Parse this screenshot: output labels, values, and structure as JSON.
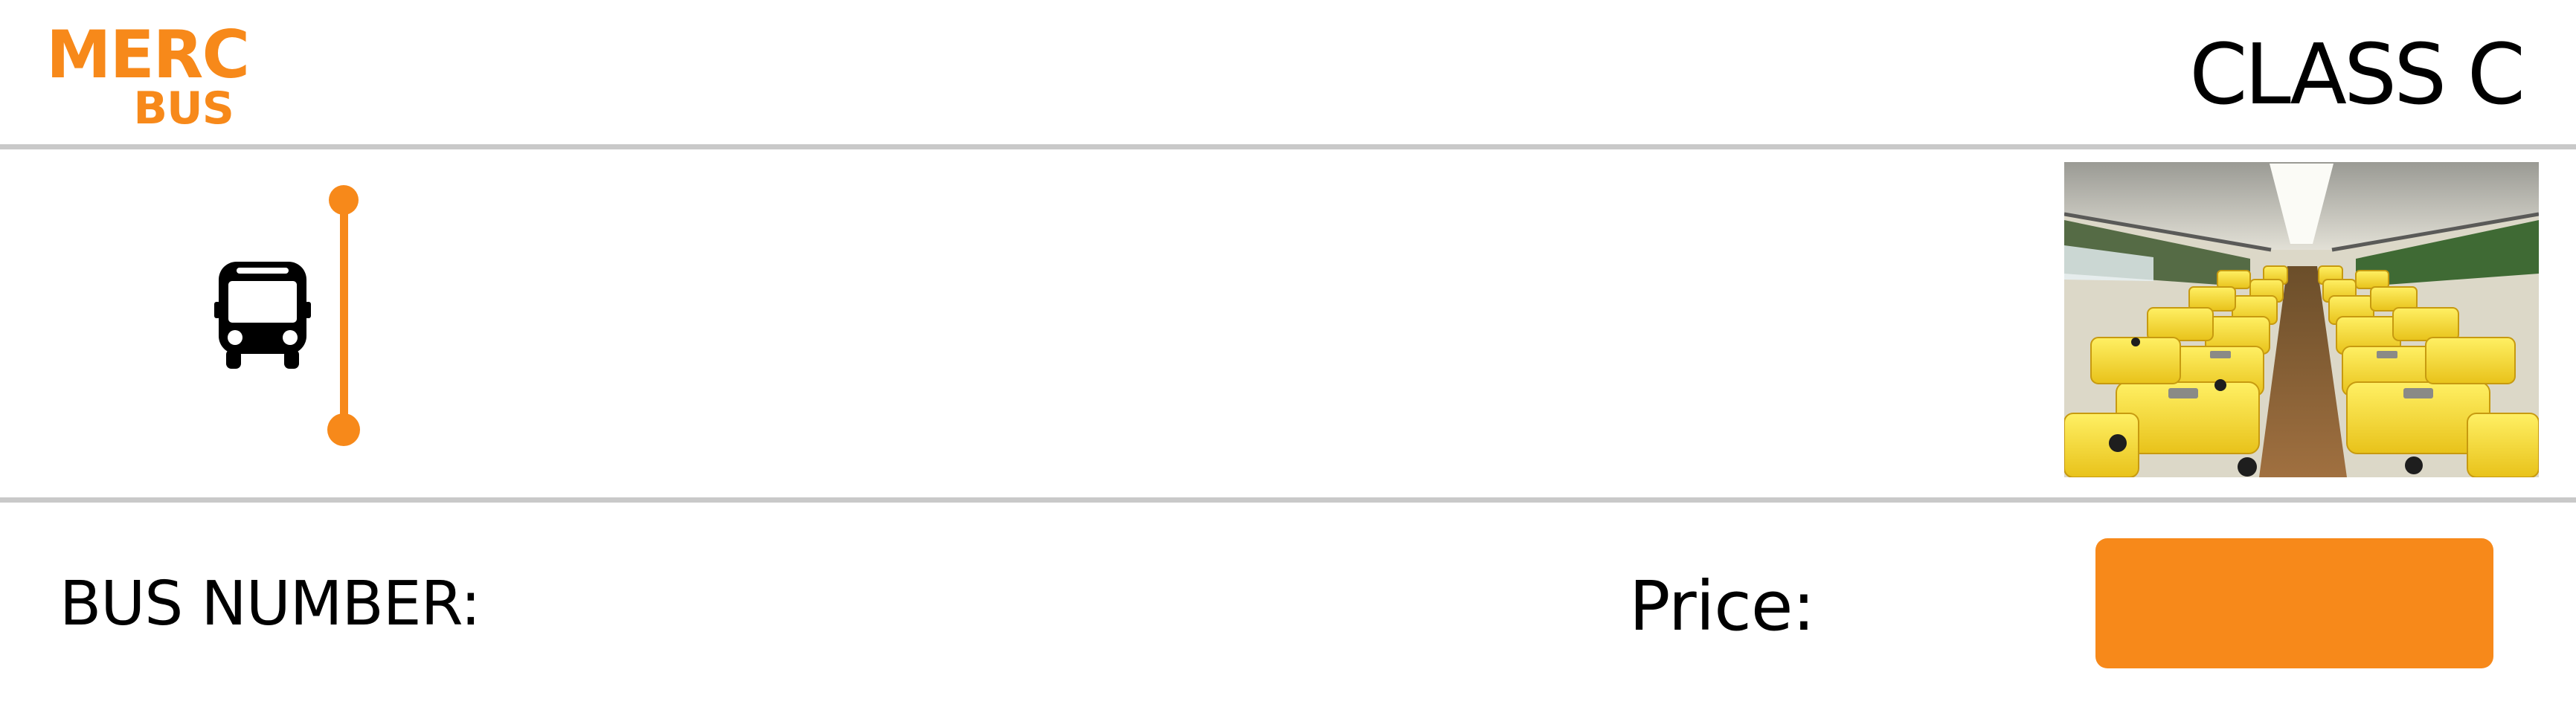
{
  "logo": {
    "line1": "MERC",
    "line2": "BUS"
  },
  "ticket": {
    "class_title": "CLASS C",
    "bus_number_label": "BUS NUMBER:",
    "price_label": "Price:",
    "price_button_label": ""
  },
  "icons": {
    "bus": "bus-icon",
    "route": "route-line-icon",
    "photo": "bus-interior-photo"
  },
  "colors": {
    "accent": "#f7891a",
    "divider": "#c9c9c9",
    "text": "#000000"
  }
}
